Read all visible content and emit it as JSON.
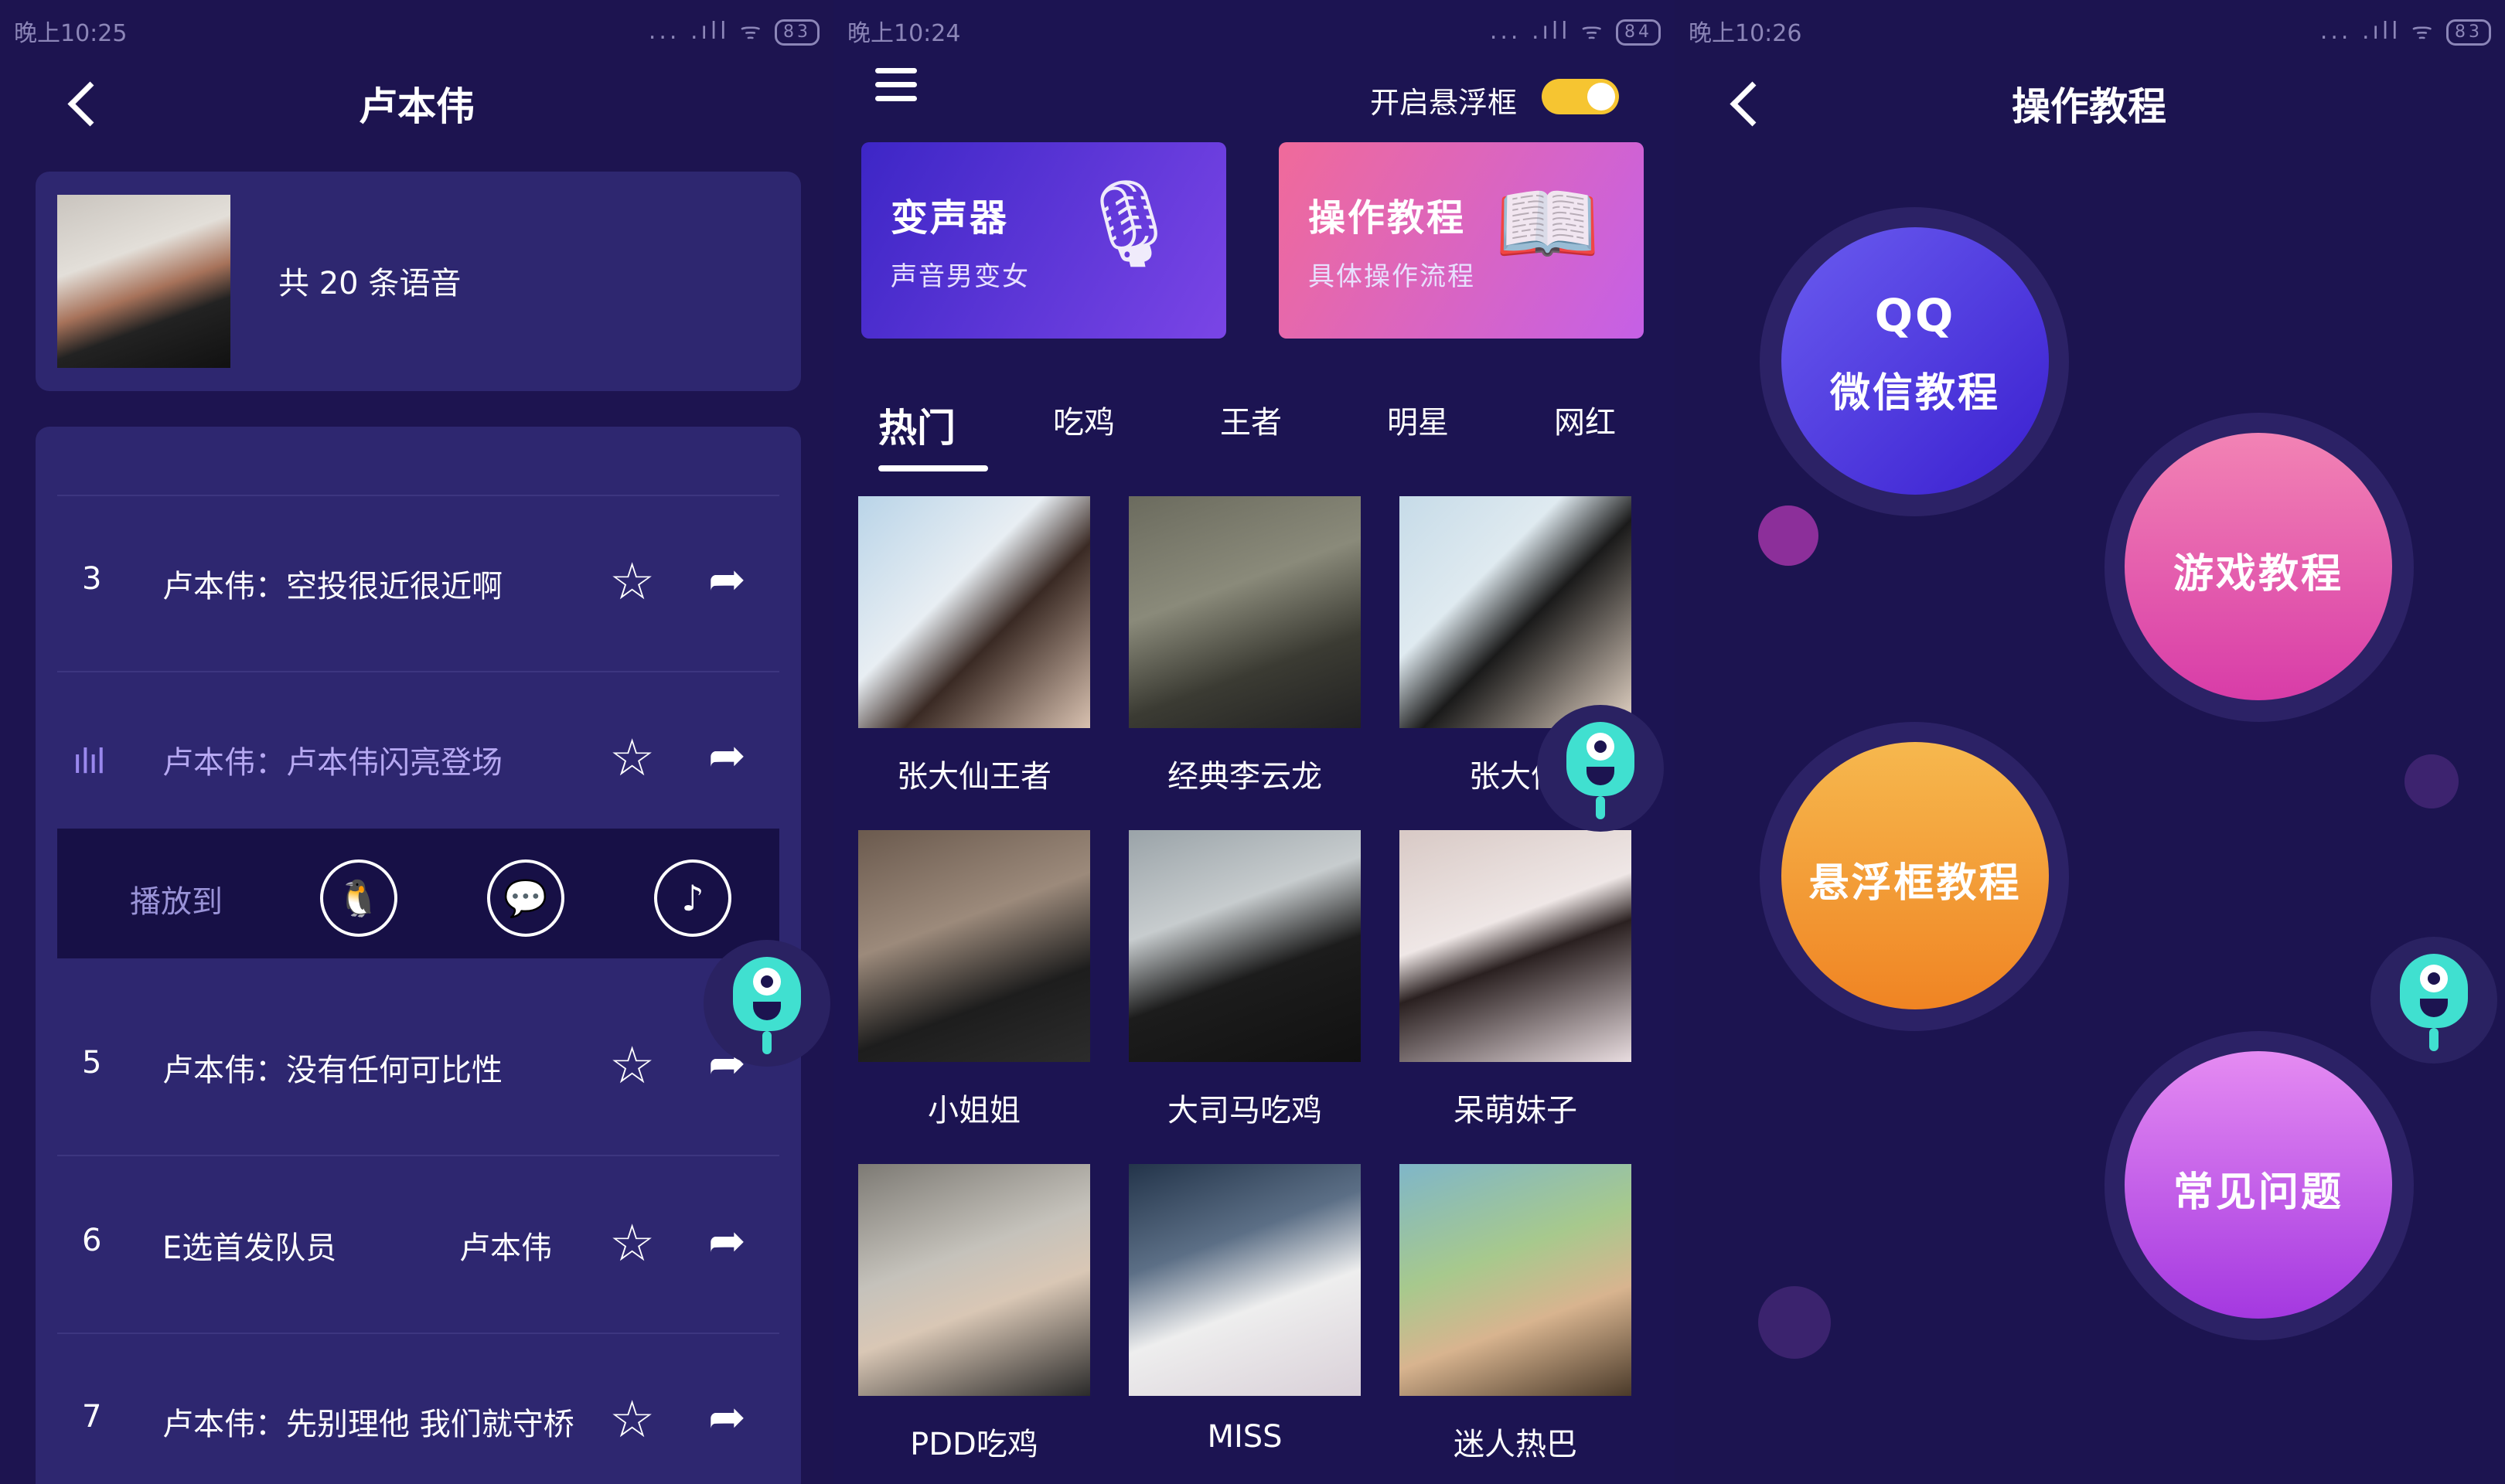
{
  "status_bars": [
    {
      "time": "晚上10:25",
      "icons": "... .ıll ᯤ",
      "battery": "83"
    },
    {
      "time": "晚上10:24",
      "icons": "... .ıll ᯤ",
      "battery": "84"
    },
    {
      "time": "晚上10:26",
      "icons": "... .ıll ᯤ",
      "battery": "83"
    }
  ],
  "panel1": {
    "title": "卢本伟",
    "artist_card": {
      "count_text": "共 20 条语音"
    },
    "rows": [
      {
        "num": "3",
        "text": "卢本伟：空投很近很近啊"
      },
      {
        "num": "",
        "text": "卢本伟：卢本伟闪亮登场",
        "playing": true
      },
      {
        "num": "5",
        "text": "卢本伟：没有任何可比性"
      },
      {
        "num": "6",
        "text": "E选首发队员",
        "extra": "卢本伟"
      },
      {
        "num": "7",
        "text": "卢本伟：先别理他 我们就守桥"
      }
    ],
    "play_to_label": "播放到"
  },
  "panel2": {
    "float_label": "开启悬浮框",
    "float_enabled": true,
    "cards": [
      {
        "title": "变声器",
        "subtitle": "声音男变女",
        "icon": "microphone-icon"
      },
      {
        "title": "操作教程",
        "subtitle": "具体操作流程",
        "icon": "book-icon"
      }
    ],
    "tabs": [
      "热门",
      "吃鸡",
      "王者",
      "明星",
      "网红"
    ],
    "active_tab": "热门",
    "tiles": [
      "张大仙王者",
      "经典李云龙",
      "张大仙",
      "小姐姐",
      "大司马吃鸡",
      "呆萌妹子",
      "PDD吃鸡",
      "MISS",
      "迷人热巴"
    ]
  },
  "panel3": {
    "title": "操作教程",
    "bubbles": [
      "QQ",
      "微信教程",
      "游戏教程",
      "悬浮框教程",
      "常见问题"
    ]
  }
}
